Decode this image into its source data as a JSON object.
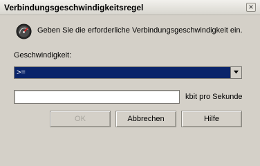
{
  "window": {
    "title": "Verbindungsgeschwindigkeitsregel",
    "close_label": "×"
  },
  "dialog": {
    "message": "Geben Sie die erforderliche Verbindungsgeschwindigkeit ein.",
    "speed_label": "Geschwindigkeit:",
    "operator": {
      "selected": ">="
    },
    "speed_input": {
      "value": "",
      "unit": "kbit pro Sekunde"
    }
  },
  "buttons": {
    "ok": "OK",
    "cancel": "Abbrechen",
    "help": "Hilfe"
  },
  "icons": {
    "message_icon": "speedometer-icon",
    "combo_arrow": "chevron-down-icon",
    "close": "close-icon"
  },
  "colors": {
    "selection": "#0a246a",
    "face": "#d4d0c8",
    "disabled_text": "#a8a59e"
  }
}
